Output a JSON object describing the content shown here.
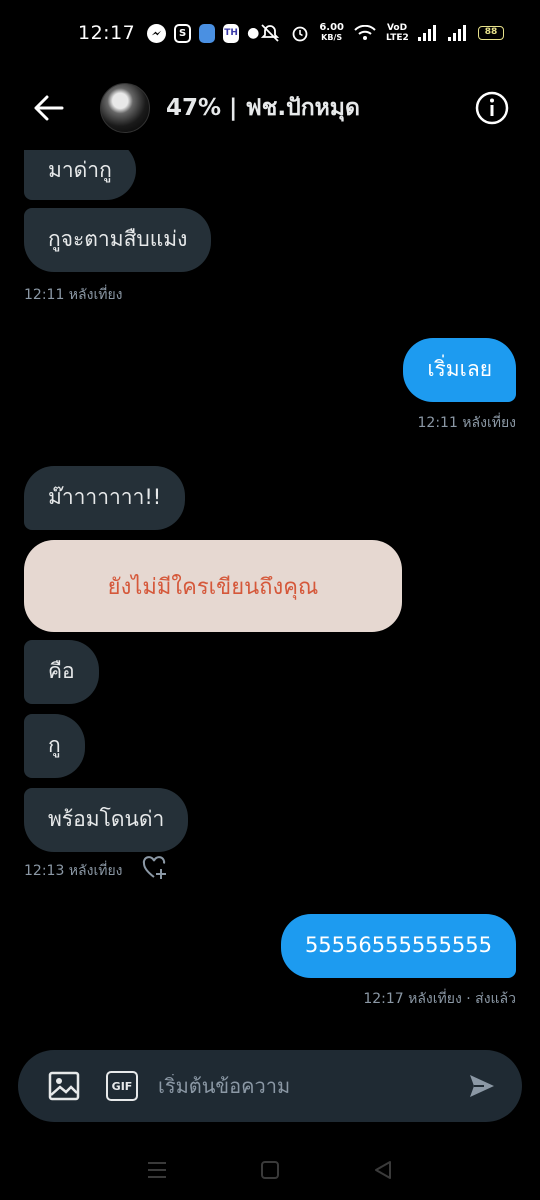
{
  "status_bar": {
    "time": "12:17",
    "speed_value": "6.00",
    "speed_unit": "KB/S",
    "network_label": "VoD LTE2",
    "battery": "88"
  },
  "header": {
    "title": "47% | ฟช.ปักหมุด"
  },
  "messages": {
    "m1": "มาด่ากู",
    "m2": "กูจะตามสืบแม่ง",
    "t1": "12:11 หลังเที่ยง",
    "m3": "เริ่มเลย",
    "t2": "12:11 หลังเที่ยง",
    "m4": "ม๊าาาาาาา!!",
    "m5": "คือ",
    "m6": "กู",
    "m7": "พร้อมโดนด่า",
    "t3": "12:13 หลังเที่ยง",
    "m8": "55556555555555",
    "t4": "12:17 หลังเที่ยง · ส่งแล้ว"
  },
  "overlay_card": {
    "text": "ยังไม่มีใครเขียนถึงคุณ"
  },
  "composer": {
    "placeholder": "เริ่มต้นข้อความ",
    "gif_label": "GIF"
  },
  "colors": {
    "accent": "#1d9bf0",
    "incoming_bubble": "#253038",
    "overlay_text": "#d5583a",
    "overlay_bg": "#e6d8d1"
  }
}
